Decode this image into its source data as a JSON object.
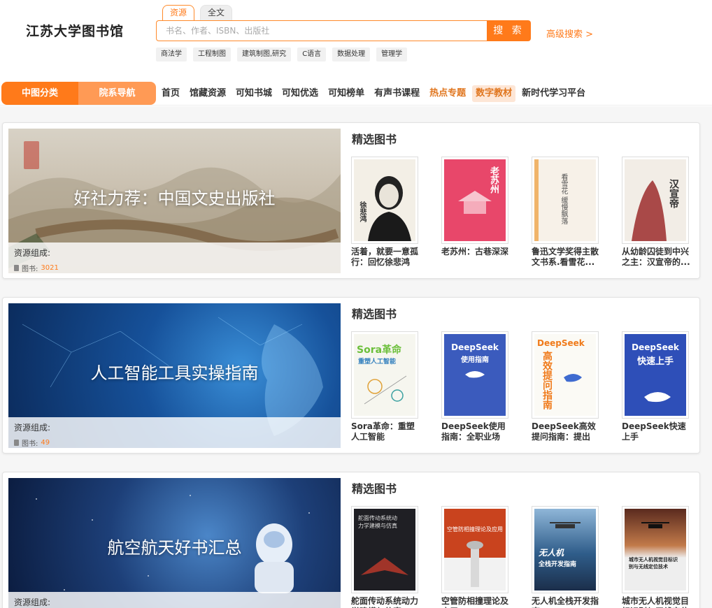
{
  "header": {
    "logo": "江苏大学图书馆",
    "search_tabs": [
      "资源",
      "全文"
    ],
    "search_placeholder": "书名、作者、ISBN、出版社",
    "search_button": "搜 索",
    "advanced_search": "高级搜索 >",
    "hot_tags": [
      "商法学",
      "工程制图",
      "建筑制图,研究",
      "C语言",
      "数据处理",
      "管理学"
    ]
  },
  "nav": {
    "category": "中图分类",
    "department": "院系导航",
    "links": [
      "首页",
      "馆藏资源",
      "可知书城",
      "可知优选",
      "可知榜单",
      "有声书课程",
      "热点专题",
      "数字教材",
      "新时代学习平台"
    ]
  },
  "sections": [
    {
      "banner_title": "好社力荐：中国文史出版社",
      "resource_label": "资源组成:",
      "resource_type": "图书:",
      "resource_count": "3021",
      "featured_label": "精选图书",
      "books": [
        {
          "title": "活着，就要一意孤行：回忆徐悲鸿"
        },
        {
          "title": "老苏州：古巷深深"
        },
        {
          "title": "鲁迅文学奖得主散文书系.看雪花..."
        },
        {
          "title": "从幼龄囚徒到中兴之主：汉宣帝的..."
        }
      ]
    },
    {
      "banner_title": "人工智能工具实操指南",
      "resource_label": "资源组成:",
      "resource_type": "图书:",
      "resource_count": "49",
      "featured_label": "精选图书",
      "books": [
        {
          "title": "Sora革命：重塑人工智能"
        },
        {
          "title": "DeepSeek使用指南：全职业场景..."
        },
        {
          "title": "DeepSeek高效提问指南：提出好..."
        },
        {
          "title": "DeepSeek快速上手"
        }
      ]
    },
    {
      "banner_title": "航空航天好书汇总",
      "resource_label": "资源组成:",
      "featured_label": "精选图书",
      "books": [
        {
          "title": "舵面传动系统动力学建模与仿真"
        },
        {
          "title": "空管防相撞理论及应用"
        },
        {
          "title": "无人机全栈开发指南"
        },
        {
          "title": "城市无人机视觉目标识别与无线定位技术"
        }
      ]
    }
  ],
  "covers": {
    "c1": {
      "name": "徐悲鸿"
    },
    "c2": {
      "name": "老苏州"
    },
    "c3": {
      "name": "看雪花 缓慢飘落"
    },
    "c4": {
      "name": "汉宣帝"
    },
    "c5": {
      "name": "Sora革命",
      "sub": "重塑人工智能"
    },
    "c6": {
      "name": "DeepSeek",
      "sub": "使用指南"
    },
    "c7": {
      "name": "DeepSeek",
      "sub": "高效提问指南"
    },
    "c8": {
      "name": "DeepSeek",
      "sub": "快速上手"
    },
    "c9": {
      "name": "舵面传动系统动力学建模与仿真"
    },
    "c10": {
      "name": "空管防相撞理论及应用"
    },
    "c11": {
      "name": "无人机",
      "sub": "全栈开发指南"
    },
    "c12": {
      "name": "城市无人机视觉目标识别与无线定位技术"
    }
  },
  "colors": {
    "accent": "#ff7a1a",
    "accent_light": "#ff9a55"
  }
}
